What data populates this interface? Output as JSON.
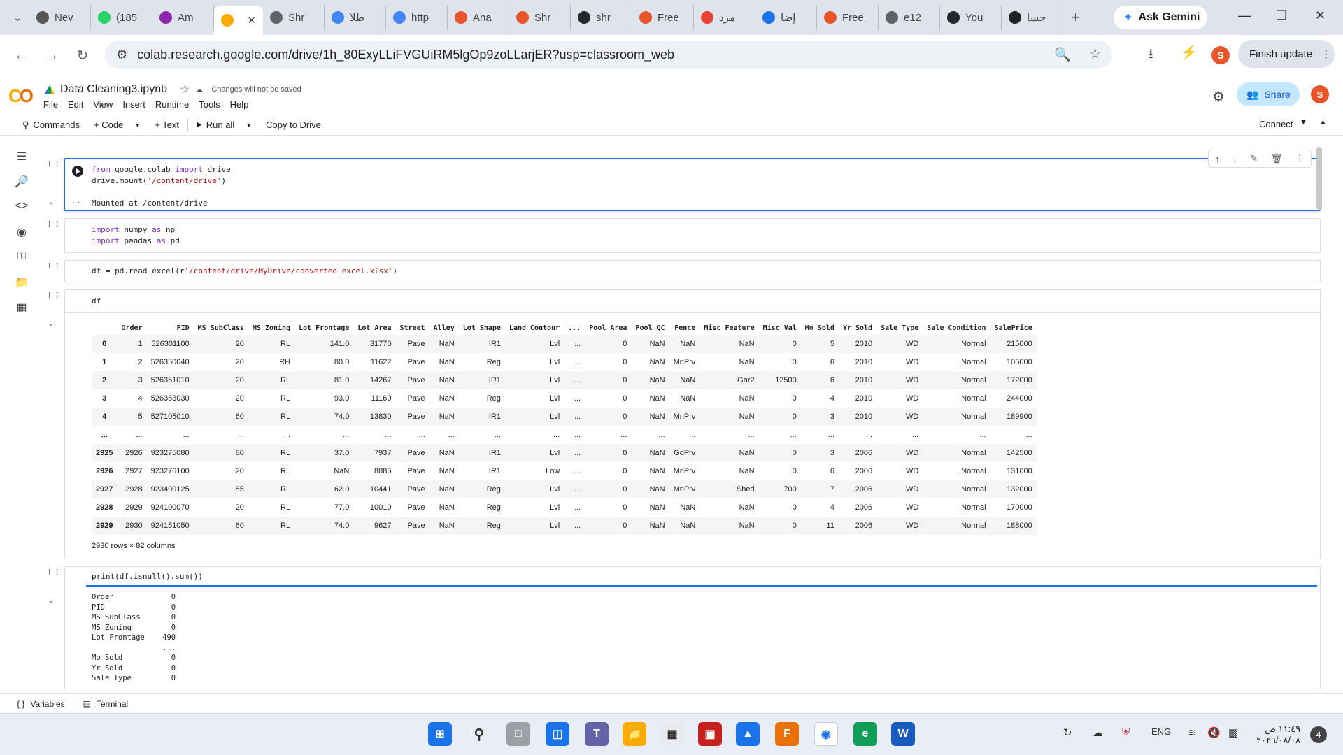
{
  "browser": {
    "tabs": [
      {
        "label": "Nev",
        "icon": "chrome-icon",
        "color": "#555555"
      },
      {
        "label": "(185",
        "icon": "whatsapp-icon",
        "color": "#25d366"
      },
      {
        "label": "Am",
        "icon": "classroom-icon",
        "color": "#8e24aa"
      },
      {
        "label": "Colab",
        "icon": "colab-icon",
        "color": "#f9ab00",
        "active": true
      },
      {
        "label": "Shr",
        "icon": "globe-icon",
        "color": "#5f6368"
      },
      {
        "label": "طلا",
        "icon": "gemini-icon",
        "color": "#4285f4"
      },
      {
        "label": "http",
        "icon": "google-icon",
        "color": "#4285f4"
      },
      {
        "label": "Ana",
        "icon": "app-icon",
        "color": "#e8552b"
      },
      {
        "label": "Shr",
        "icon": "app-icon",
        "color": "#e8552b"
      },
      {
        "label": "shr",
        "icon": "github-icon",
        "color": "#24292e"
      },
      {
        "label": "Free",
        "icon": "fox-icon",
        "color": "#e8552b"
      },
      {
        "label": "مرد",
        "icon": "gmail-icon",
        "color": "#ea4335"
      },
      {
        "label": "إضا",
        "icon": "app-icon",
        "color": "#1a73e8"
      },
      {
        "label": "Free",
        "icon": "fox-icon",
        "color": "#e8552b"
      },
      {
        "label": "e12",
        "icon": "globe-icon",
        "color": "#5f6368"
      },
      {
        "label": "You",
        "icon": "github-icon",
        "color": "#24292e"
      },
      {
        "label": "حسا",
        "icon": "app-icon",
        "color": "#202124"
      }
    ],
    "ask_gemini": "Ask Gemini",
    "url": "colab.research.google.com/drive/1h_80ExyLLiFVGUiRM5lgOp9zoLLarjER?usp=classroom_web",
    "finish_update": "Finish update",
    "profile_letter": "S"
  },
  "colab": {
    "notebook_title": "Data Cleaning3.ipynb",
    "unsaved_note": "Changes will not be saved",
    "menus": [
      "File",
      "Edit",
      "View",
      "Insert",
      "Runtime",
      "Tools",
      "Help"
    ],
    "share_label": "Share",
    "user_letter": "S",
    "toolbar": {
      "commands": "Commands",
      "code": "+ Code",
      "text": "+ Text",
      "run_all": "Run all",
      "copy_to_drive": "Copy to Drive",
      "connect": "Connect"
    }
  },
  "cells": {
    "cell1": {
      "line1_a": "from",
      "line1_b": " google.colab ",
      "line1_c": "import",
      "line1_d": " drive",
      "line2_a": "drive.mount(",
      "line2_b": "'/content/drive'",
      "line2_c": ")",
      "output": "Mounted at /content/drive"
    },
    "cell2": {
      "line1_a": "import",
      "line1_b": " numpy ",
      "line1_c": "as",
      "line1_d": " np",
      "line2_a": "import",
      "line2_b": " pandas ",
      "line2_c": "as",
      "line2_d": " pd"
    },
    "cell3": {
      "line1_a": "df = pd.read_excel(r",
      "line1_b": "'/content/drive/MyDrive/converted_excel.xlsx'",
      "line1_c": ")"
    },
    "cell4": {
      "code": "df",
      "columns": [
        "",
        "Order",
        "PID",
        "MS SubClass",
        "MS Zoning",
        "Lot Frontage",
        "Lot Area",
        "Street",
        "Alley",
        "Lot Shape",
        "Land Contour",
        "...",
        "Pool Area",
        "Pool QC",
        "Fence",
        "Misc Feature",
        "Misc Val",
        "Mo Sold",
        "Yr Sold",
        "Sale Type",
        "Sale Condition",
        "SalePrice"
      ],
      "rows": [
        [
          "0",
          "1",
          "526301100",
          "20",
          "RL",
          "141.0",
          "31770",
          "Pave",
          "NaN",
          "IR1",
          "Lvl",
          "...",
          "0",
          "NaN",
          "NaN",
          "NaN",
          "0",
          "5",
          "2010",
          "WD",
          "Normal",
          "215000"
        ],
        [
          "1",
          "2",
          "526350040",
          "20",
          "RH",
          "80.0",
          "11622",
          "Pave",
          "NaN",
          "Reg",
          "Lvl",
          "...",
          "0",
          "NaN",
          "MnPrv",
          "NaN",
          "0",
          "6",
          "2010",
          "WD",
          "Normal",
          "105000"
        ],
        [
          "2",
          "3",
          "526351010",
          "20",
          "RL",
          "81.0",
          "14267",
          "Pave",
          "NaN",
          "IR1",
          "Lvl",
          "...",
          "0",
          "NaN",
          "NaN",
          "Gar2",
          "12500",
          "6",
          "2010",
          "WD",
          "Normal",
          "172000"
        ],
        [
          "3",
          "4",
          "526353030",
          "20",
          "RL",
          "93.0",
          "11160",
          "Pave",
          "NaN",
          "Reg",
          "Lvl",
          "...",
          "0",
          "NaN",
          "NaN",
          "NaN",
          "0",
          "4",
          "2010",
          "WD",
          "Normal",
          "244000"
        ],
        [
          "4",
          "5",
          "527105010",
          "60",
          "RL",
          "74.0",
          "13830",
          "Pave",
          "NaN",
          "IR1",
          "Lvl",
          "...",
          "0",
          "NaN",
          "MnPrv",
          "NaN",
          "0",
          "3",
          "2010",
          "WD",
          "Normal",
          "189900"
        ],
        [
          "...",
          "...",
          "...",
          "...",
          "...",
          "...",
          "...",
          "...",
          "...",
          "...",
          "...",
          "...",
          "...",
          "...",
          "...",
          "...",
          "...",
          "...",
          "...",
          "...",
          "...",
          "..."
        ],
        [
          "2925",
          "2926",
          "923275080",
          "80",
          "RL",
          "37.0",
          "7937",
          "Pave",
          "NaN",
          "IR1",
          "Lvl",
          "...",
          "0",
          "NaN",
          "GdPrv",
          "NaN",
          "0",
          "3",
          "2006",
          "WD",
          "Normal",
          "142500"
        ],
        [
          "2926",
          "2927",
          "923276100",
          "20",
          "RL",
          "NaN",
          "8885",
          "Pave",
          "NaN",
          "IR1",
          "Low",
          "...",
          "0",
          "NaN",
          "MnPrv",
          "NaN",
          "0",
          "6",
          "2006",
          "WD",
          "Normal",
          "131000"
        ],
        [
          "2927",
          "2928",
          "923400125",
          "85",
          "RL",
          "62.0",
          "10441",
          "Pave",
          "NaN",
          "Reg",
          "Lvl",
          "...",
          "0",
          "NaN",
          "MnPrv",
          "Shed",
          "700",
          "7",
          "2006",
          "WD",
          "Normal",
          "132000"
        ],
        [
          "2928",
          "2929",
          "924100070",
          "20",
          "RL",
          "77.0",
          "10010",
          "Pave",
          "NaN",
          "Reg",
          "Lvl",
          "...",
          "0",
          "NaN",
          "NaN",
          "NaN",
          "0",
          "4",
          "2006",
          "WD",
          "Normal",
          "170000"
        ],
        [
          "2929",
          "2930",
          "924151050",
          "60",
          "RL",
          "74.0",
          "9627",
          "Pave",
          "NaN",
          "Reg",
          "Lvl",
          "...",
          "0",
          "NaN",
          "NaN",
          "NaN",
          "0",
          "11",
          "2006",
          "WD",
          "Normal",
          "188000"
        ]
      ],
      "shape": "2930 rows × 82 columns"
    },
    "cell5": {
      "code_a": "print(df.isnull().sum())",
      "output": "Order             0\nPID               0\nMS SubClass       0\nMS Zoning         0\nLot Frontage    490\n                ...\nMo Sold           0\nYr Sold           0\nSale Type         0"
    }
  },
  "statusbar": {
    "variables": "Variables",
    "terminal": "Terminal"
  },
  "taskbar": {
    "lang": "ENG",
    "time": "١١:٤٩ ص",
    "date": "٢٠٢٦/٠٨/٠٨",
    "notifications": "4"
  }
}
